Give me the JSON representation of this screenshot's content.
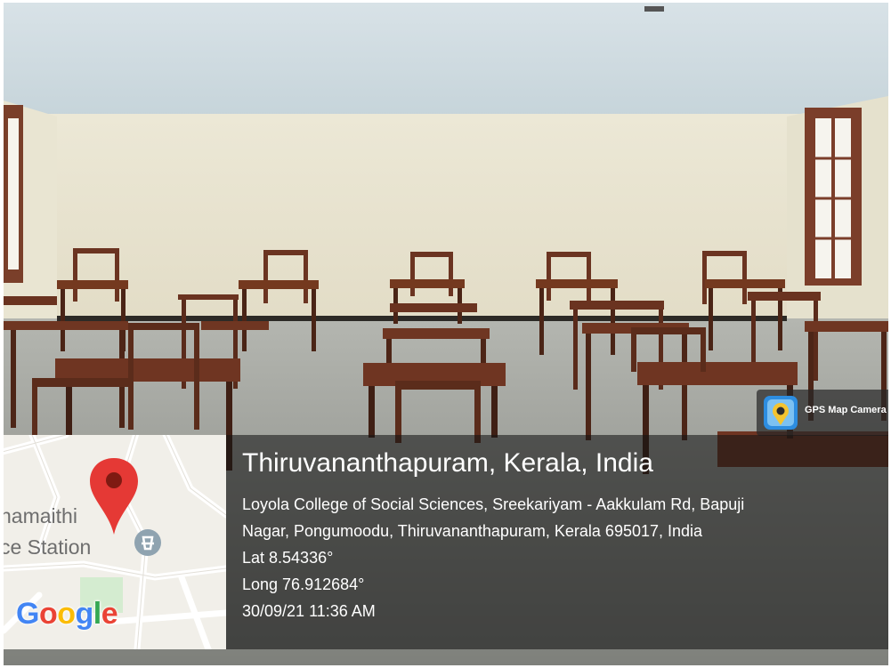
{
  "camera_badge": {
    "label": "GPS Map Camera",
    "icon": "map-pin-camera-icon"
  },
  "map": {
    "place_fragment": "namaithi",
    "station_fragment": "ce Station",
    "provider_logo_letters": [
      "G",
      "o",
      "o",
      "g",
      "l",
      "e"
    ],
    "provider_logo_colors": [
      "#4285F4",
      "#EA4335",
      "#FBBC05",
      "#4285F4",
      "#34A853",
      "#EA4335"
    ],
    "pin_color": "#E53935",
    "poi_icon": "police-station-icon"
  },
  "location": {
    "title": "Thiruvananthapuram, Kerala, India",
    "address_line1": "Loyola College of Social Sciences, Sreekariyam - Aakkulam Rd, Bapuji",
    "address_line2": "Nagar, Pongumoodu, Thiruvananthapuram, Kerala 695017, India",
    "latitude": "Lat 8.54336°",
    "longitude": "Long 76.912684°",
    "datetime": "30/09/21 11:36 AM"
  }
}
